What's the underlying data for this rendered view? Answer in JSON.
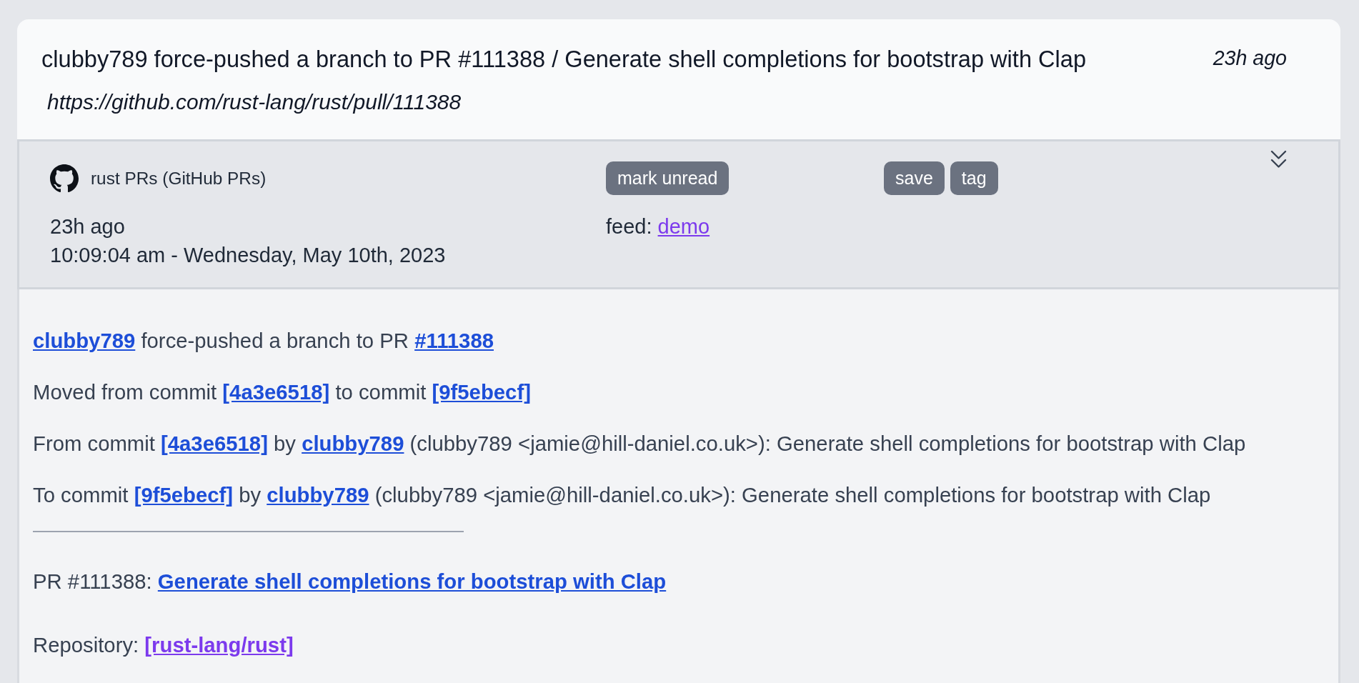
{
  "entry": {
    "title": "clubby789 force-pushed a branch to PR #111388 / Generate shell completions for bootstrap with Clap",
    "age": "23h ago",
    "url": "https://github.com/rust-lang/rust/pull/111388"
  },
  "meta": {
    "source": "rust PRs (GitHub PRs)",
    "age": "23h ago",
    "timestamp": "10:09:04 am - Wednesday, May 10th, 2023",
    "read_action": "mark unread",
    "actions": [
      "save",
      "tag"
    ],
    "feed": {
      "label": "feed:",
      "link": "demo",
      "visited": true
    }
  },
  "content": {
    "events": [
      {
        "segments": [
          {
            "kind": "user",
            "text": "clubby789",
            "visited": false
          },
          {
            "kind": "text",
            "text": "force-pushed a branch to PR"
          },
          {
            "kind": "pr",
            "text": "#111388",
            "visited": false
          }
        ]
      },
      {
        "segments": [
          {
            "kind": "text",
            "text": "Moved from commit"
          },
          {
            "kind": "commit",
            "text": "[4a3e6518]",
            "visited": false
          },
          {
            "kind": "text",
            "text": "to commit"
          },
          {
            "kind": "commit",
            "text": "[9f5ebecf]",
            "visited": false
          }
        ]
      },
      {
        "segments": [
          {
            "kind": "text",
            "text": "From commit"
          },
          {
            "kind": "commit",
            "text": "[4a3e6518]",
            "visited": false
          },
          {
            "kind": "text",
            "text": "by"
          },
          {
            "kind": "user",
            "text": "clubby789",
            "visited": false
          },
          {
            "kind": "text",
            "text": "(clubby789 <jamie@hill-daniel.co.uk>): Generate shell completions for bootstrap with Clap"
          }
        ]
      },
      {
        "segments": [
          {
            "kind": "text",
            "text": "To commit"
          },
          {
            "kind": "commit",
            "text": "[9f5ebecf]",
            "visited": false
          },
          {
            "kind": "text",
            "text": "by"
          },
          {
            "kind": "user",
            "text": "clubby789",
            "visited": false
          },
          {
            "kind": "text",
            "text": "(clubby789 <jamie@hill-daniel.co.uk>): Generate shell completions for bootstrap with Clap"
          }
        ]
      }
    ],
    "details": [
      {
        "segments": [
          {
            "kind": "text",
            "text": "PR #111388:"
          },
          {
            "kind": "title",
            "text": "Generate shell completions for bootstrap with Clap",
            "visited": false
          }
        ]
      },
      {
        "segments": [
          {
            "kind": "text",
            "text": "Repository:"
          },
          {
            "kind": "repo",
            "text": "[rust-lang/rust]",
            "visited": true
          }
        ]
      }
    ]
  }
}
